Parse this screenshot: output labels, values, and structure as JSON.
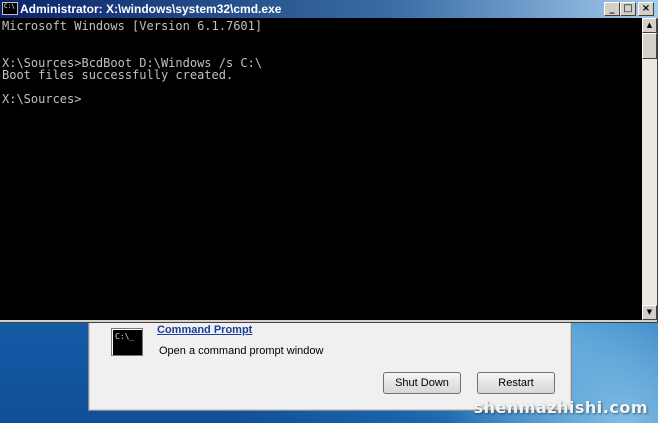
{
  "window": {
    "title": "Administrator: X:\\windows\\system32\\cmd.exe",
    "icon_text": "C:\\",
    "controls": {
      "minimize": "_",
      "maximize": "□",
      "close": "×"
    }
  },
  "console": {
    "lines": [
      "Microsoft Windows [Version 6.1.7601]",
      "",
      "X:\\Sources>BcdBoot D:\\Windows /s C:\\",
      "Boot files successfully created.",
      "",
      "X:\\Sources>"
    ],
    "text_color": "#c0c0c0",
    "background": "#000000"
  },
  "recovery_dialog": {
    "icon_text": "C:\\_",
    "title": "Command Prompt",
    "description": "Open a command prompt window",
    "buttons": {
      "shutdown": "Shut Down",
      "restart": "Restart"
    }
  },
  "watermark": "shenmazhishi.com"
}
